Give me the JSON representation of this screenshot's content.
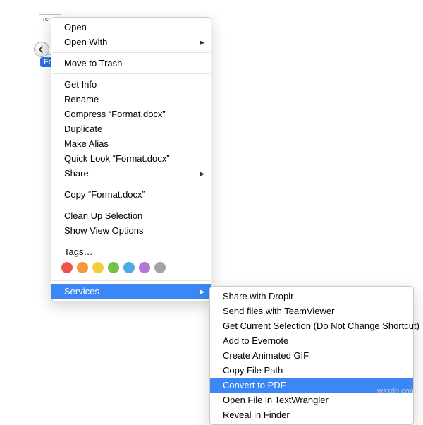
{
  "file": {
    "badge": "TC",
    "name_truncated": "Forma",
    "name": "Format.docx"
  },
  "menu": {
    "open": "Open",
    "open_with": "Open With",
    "move_to_trash": "Move to Trash",
    "get_info": "Get Info",
    "rename": "Rename",
    "compress": "Compress “Format.docx”",
    "duplicate": "Duplicate",
    "make_alias": "Make Alias",
    "quick_look": "Quick Look “Format.docx”",
    "share": "Share",
    "copy": "Copy “Format.docx”",
    "clean_up": "Clean Up Selection",
    "show_view_options": "Show View Options",
    "tags_label": "Tags…",
    "services": "Services"
  },
  "tag_colors": [
    "#ef534f",
    "#f3983c",
    "#f2cd41",
    "#72c04e",
    "#4fa9e3",
    "#b279d4",
    "#a3a3a3"
  ],
  "submenu": {
    "share_droplr": "Share with Droplr",
    "send_teamviewer": "Send files with TeamViewer",
    "get_selection": "Get Current Selection (Do Not Change Shortcut)",
    "add_evernote": "Add to Evernote",
    "create_gif": "Create Animated GIF",
    "copy_file_path": "Copy File Path",
    "convert_pdf": "Convert to PDF",
    "open_textwrangler": "Open File in TextWrangler",
    "reveal_finder": "Reveal in Finder"
  },
  "watermark": "wsxdn.com"
}
